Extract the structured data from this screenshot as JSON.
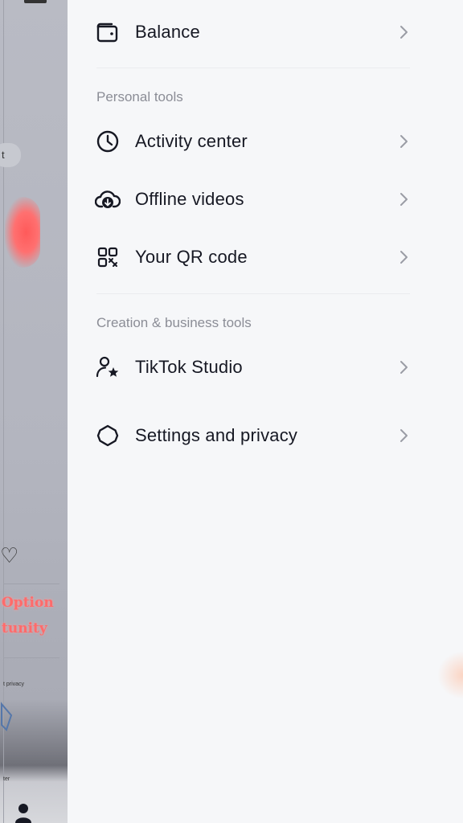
{
  "background_peek": {
    "pill_text": "t",
    "promo_line1": "Option",
    "promo_line2": "tunity",
    "small_text": "t privacy",
    "small_text2": "ter"
  },
  "drawer": {
    "balance": {
      "label": "Balance",
      "icon": "wallet-icon"
    },
    "personal_tools": {
      "title": "Personal tools",
      "items": [
        {
          "label": "Activity center",
          "icon": "clock-icon"
        },
        {
          "label": "Offline videos",
          "icon": "cloud-download-icon"
        },
        {
          "label": "Your QR code",
          "icon": "qr-code-icon"
        }
      ]
    },
    "creation_tools": {
      "title": "Creation & business tools",
      "items": [
        {
          "label": "TikTok Studio",
          "icon": "user-star-icon"
        }
      ]
    },
    "settings": {
      "label": "Settings and privacy",
      "icon": "gear-icon"
    }
  },
  "colors": {
    "text": "#161823",
    "section": "#8b8d96",
    "chevron": "#9a9ca5",
    "drawer_bg": "#f6f7f9"
  }
}
